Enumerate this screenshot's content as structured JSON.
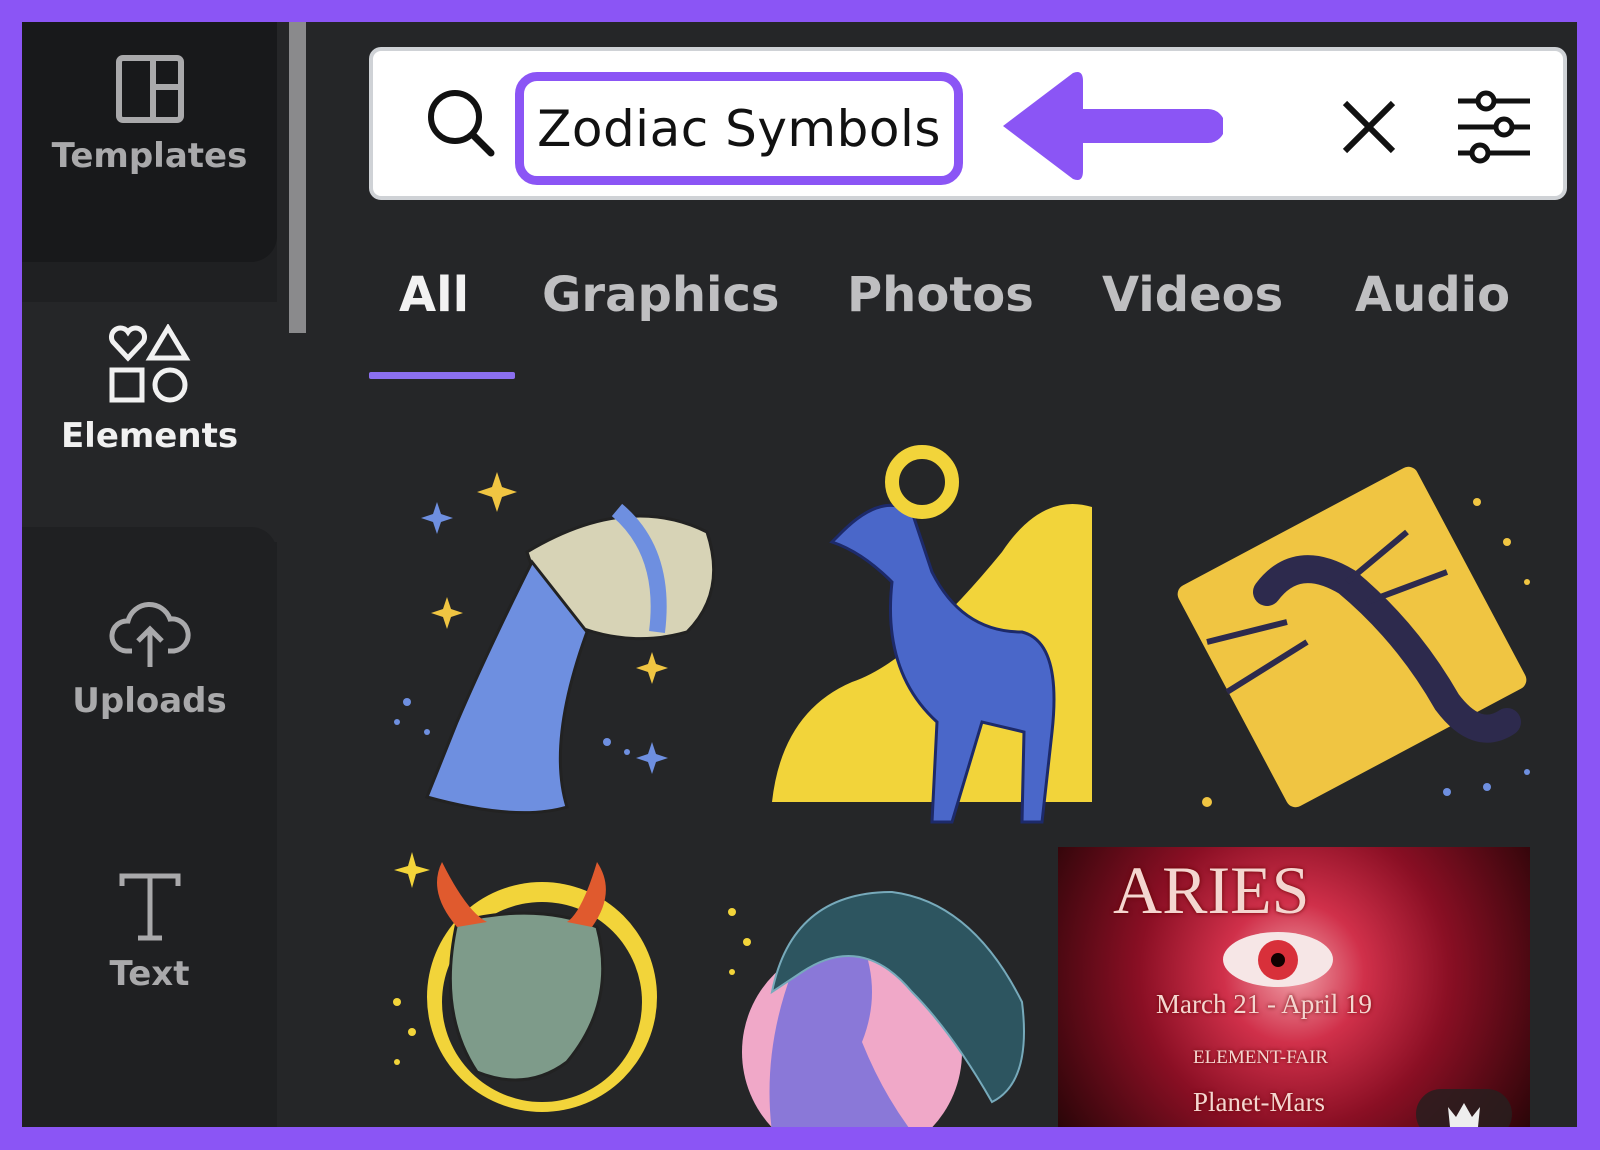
{
  "sidebar": {
    "items": [
      {
        "label": "Templates",
        "icon": "templates-icon"
      },
      {
        "label": "Elements",
        "icon": "elements-icon",
        "active": true
      },
      {
        "label": "Uploads",
        "icon": "upload-cloud-icon"
      },
      {
        "label": "Text",
        "icon": "text-icon"
      }
    ]
  },
  "search": {
    "value": "Zodiac Symbols"
  },
  "tabs": [
    {
      "label": "All",
      "active": true
    },
    {
      "label": "Graphics"
    },
    {
      "label": "Photos"
    },
    {
      "label": "Videos"
    },
    {
      "label": "Audio"
    }
  ],
  "results": {
    "aries": {
      "title": "ARIES",
      "dates": "March 21 - April 19",
      "element": "ELEMENT-FAIR",
      "planet": "Planet-Mars",
      "badge": "crown-icon"
    }
  },
  "colors": {
    "accent": "#8b55f5",
    "background": "#252628",
    "sidebar": "#1f2022"
  }
}
